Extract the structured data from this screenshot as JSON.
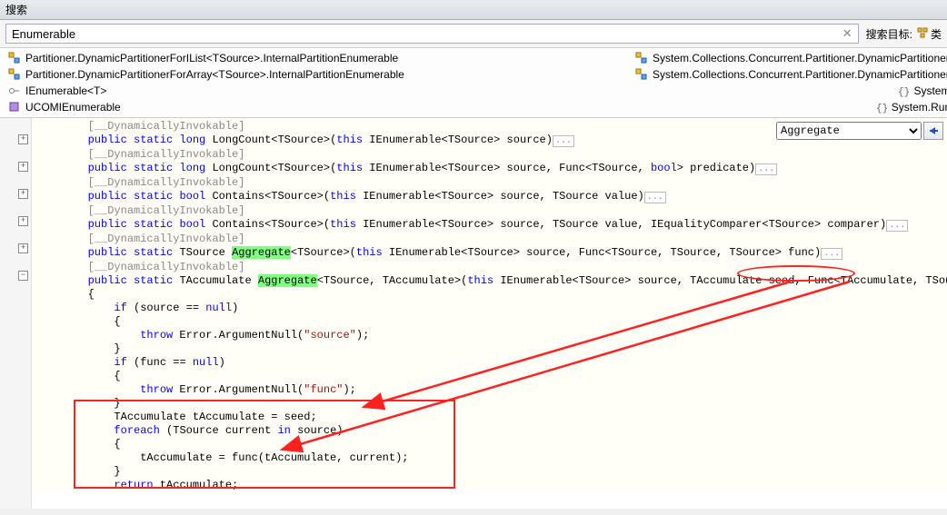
{
  "header": {
    "title": "搜索"
  },
  "search": {
    "value": "Enumerable",
    "clear": "✕",
    "target_label": "搜索目标:",
    "class_icon": "类"
  },
  "results_left": [
    "Partitioner.DynamicPartitionerForIList<TSource>.InternalPartitionEnumerable",
    "Partitioner.DynamicPartitionerForArray<TSource>.InternalPartitionEnumerable",
    "IEnumerable<T>",
    "UCOMIEnumerable"
  ],
  "results_right": [
    "System.Collections.Concurrent.Partitioner.DynamicPartitionerForILis",
    "System.Collections.Concurrent.Partitioner.DynamicPartitionerForArra",
    "System.Collect",
    "System.Runtime.Int"
  ],
  "member_dropdown": {
    "value": "Aggregate"
  },
  "code": {
    "l1a": "        [__DynamicallyInvokable]",
    "l2": {
      "pre": "        ",
      "kw1": "public",
      "kw2": "static",
      "kw3": "long",
      "sig": " LongCount<TSource>(",
      "kw4": "this",
      "rest": " IEnumerable<TSource> source)"
    },
    "l3a": "        [__DynamicallyInvokable]",
    "l4": {
      "pre": "        ",
      "kw1": "public",
      "kw2": "static",
      "kw3": "long",
      "sig": " LongCount<TSource>(",
      "kw4": "this",
      "mid": " IEnumerable<TSource> source, Func<TSource, ",
      "kw5": "bool",
      "rest": "> predicate)"
    },
    "l5a": "        [__DynamicallyInvokable]",
    "l6": {
      "pre": "        ",
      "kw1": "public",
      "kw2": "static",
      "kw3": "bool",
      "sig": " Contains<TSource>(",
      "kw4": "this",
      "rest": " IEnumerable<TSource> source, TSource value)"
    },
    "l7a": "        [__DynamicallyInvokable]",
    "l8": {
      "pre": "        ",
      "kw1": "public",
      "kw2": "static",
      "kw3": "bool",
      "sig": " Contains<TSource>(",
      "kw4": "this",
      "rest": " IEnumerable<TSource> source, TSource value, IEqualityComparer<TSource> comparer)"
    },
    "l9a": "        [__DynamicallyInvokable]",
    "l10": {
      "pre": "        ",
      "kw1": "public",
      "kw2": "static",
      "sig1": " TSource ",
      "hl": "Aggregate",
      "sig2": "<TSource>(",
      "kw4": "this",
      "rest": " IEnumerable<TSource> source, Func<TSource, TSource, TSource> func)"
    },
    "l11a": "        [__DynamicallyInvokable]",
    "l12": {
      "pre": "        ",
      "kw1": "public",
      "kw2": "static",
      "sig1": " TAccumulate ",
      "hl": "Aggregate",
      "sig2": "<TSource, TAccumulate>(",
      "kw4": "this",
      "mid": " IEnumerable<TSource> source, TAccumulate seed, Func<TAccumulate, TSource"
    },
    "l13": "        {",
    "l14": {
      "pre": "            ",
      "kw": "if",
      "rest": " (source == ",
      "kw2": "null",
      "end": ")"
    },
    "l15": "            {",
    "l16": {
      "pre": "                ",
      "kw": "throw",
      "mid": " Error.ArgumentNull(",
      "str": "\"source\"",
      "end": ");"
    },
    "l17": "            }",
    "l18": {
      "pre": "            ",
      "kw": "if",
      "rest": " (func == ",
      "kw2": "null",
      "end": ")"
    },
    "l19": "            {",
    "l20": {
      "pre": "                ",
      "kw": "throw",
      "mid": " Error.ArgumentNull(",
      "str": "\"func\"",
      "end": ");"
    },
    "l21": "            }",
    "l22": "            TAccumulate tAccumulate = seed;",
    "l23": {
      "pre": "            ",
      "kw": "foreach",
      "mid": " (TSource current ",
      "kw2": "in",
      "end": " source)"
    },
    "l24": "            {",
    "l25": "                tAccumulate = func(tAccumulate, current);",
    "l26": "            }",
    "l27": {
      "pre": "            ",
      "kw": "return",
      "end": " tAccumulate;"
    }
  }
}
